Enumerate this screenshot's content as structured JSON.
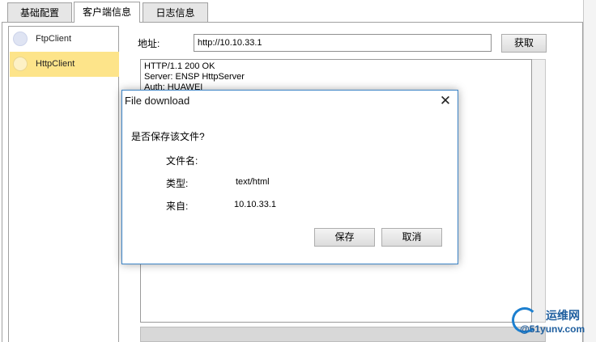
{
  "tabs": [
    {
      "label": "基础配置"
    },
    {
      "label": "客户端信息"
    },
    {
      "label": "日志信息"
    }
  ],
  "sidebar": {
    "items": [
      {
        "label": "FtpClient"
      },
      {
        "label": "HttpClient"
      }
    ]
  },
  "address": {
    "label": "地址:",
    "value": "http://10.10.33.1",
    "fetch_button": "获取"
  },
  "response": {
    "lines": [
      "HTTP/1.1 200 OK",
      "Server: ENSP HttpServer",
      "Auth: HUAWEI"
    ]
  },
  "dialog": {
    "title": "File download",
    "close": "✕",
    "question": "是否保存该文件?",
    "filename_label": "文件名:",
    "type_label": "类型:",
    "type_value": "text/html",
    "from_label": "来自:",
    "from_value": "10.10.33.1",
    "save_button": "保存",
    "cancel_button": "取消"
  },
  "watermark": {
    "line1": "运维网",
    "line2": "@51yunv.com"
  },
  "colors": {
    "selected_item": "#fde48a",
    "dialog_border": "#3c83c5"
  }
}
